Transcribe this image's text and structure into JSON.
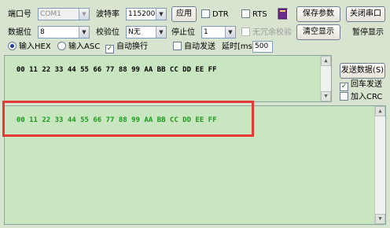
{
  "top": {
    "port_label": "端口号",
    "port_value": "COM1",
    "baud_label": "波特率",
    "baud_value": "115200",
    "apply_label": "应用",
    "dtr_label": "DTR",
    "rts_label": "RTS",
    "save_params_label": "保存参数",
    "close_port_label": "关闭串口",
    "databits_label": "数据位",
    "databits_value": "8",
    "parity_label": "校验位",
    "parity_value": "N无",
    "stopbits_label": "停止位",
    "stopbits_value": "1",
    "no_parity_label": "无冗余校验",
    "clear_display_label": "清空显示",
    "pause_display_label": "暂停显示",
    "input_hex_label": "输入HEX",
    "input_asc_label": "输入ASC",
    "auto_newline_label": "自动换行",
    "auto_send_label": "自动发送",
    "delay_label": "延时[ms",
    "delay_value": "500"
  },
  "send": {
    "content": "00 11 22 33 44 55 66 77 88 99 AA BB CC DD EE FF",
    "send_button_label": "发送数据(S)",
    "enter_send_label": "回车发送",
    "add_crc_label": "加入CRC"
  },
  "receive": {
    "content": "00 11 22 33 44 55 66 77 88 99 AA BB CC DD EE FF"
  },
  "colors": {
    "accent": "#e53935",
    "receive_text": "#1f9a1f",
    "pane_bg": "#c8e6c0"
  }
}
